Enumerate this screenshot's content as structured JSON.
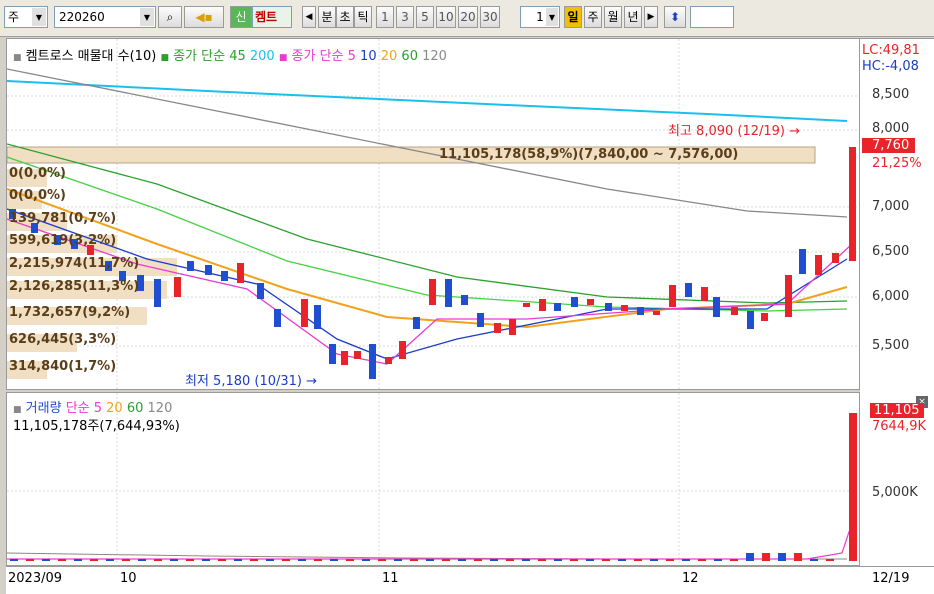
{
  "toolbar": {
    "period_select": "주",
    "code": "220260",
    "new_badge": "신",
    "stock_name": "켐트",
    "prev_arrow": "◀",
    "tabs": [
      "분",
      "초",
      "틱"
    ],
    "intervals": [
      "1",
      "3",
      "5",
      "10",
      "20",
      "30"
    ],
    "interval_value": "1",
    "periods": [
      "일",
      "주",
      "월",
      "년"
    ],
    "active_period": "일",
    "next_arrow": "▶"
  },
  "legend": {
    "title": "켐트로스 매물대 수(10)",
    "ma_long": "종가 단순 45",
    "ma_long_2": "200",
    "ma_short": "종가 단순 5",
    "ma_10": "10",
    "ma_20": "20",
    "ma_60": "60",
    "ma_120": "120"
  },
  "right_axis": {
    "lc": "LC:49,81",
    "hc": "HC:-4,08",
    "current_price": "7,760",
    "change": "21,25%",
    "ticks": [
      "8,500",
      "8,000",
      "7,000",
      "6,500",
      "6,000",
      "5,500"
    ],
    "vol_current": "11,105",
    "vol_avg": "7644,9K",
    "vol_tick": "5,000K"
  },
  "volume_profile": {
    "highlight": "11,105,178(58,9%)(7,840,00 ~ 7,576,00)",
    "rows": [
      "0(0,0%)",
      "0(0,0%)",
      "139,781(0,7%)",
      "599,619(3,2%)",
      "2,215,974(11,7%)",
      "2,126,285(11,3%)",
      "1,732,657(9,2%)",
      "626,445(3,3%)",
      "314,840(1,7%)"
    ]
  },
  "annotations": {
    "high": "최고 8,090 (12/19)",
    "low": "최저 5,180 (10/31)"
  },
  "volume_legend": {
    "title": "거래량",
    "ma": "단순 5",
    "ma_20": "20",
    "ma_60": "60",
    "ma_120": "120",
    "summary": "11,105,178주(7,644,93%)"
  },
  "x_axis": [
    "2023/09",
    "10",
    "11",
    "12",
    "12/19"
  ],
  "colors": {
    "up": "#e8232a",
    "down": "#1f4fd0",
    "ma5": "#e83cd0",
    "ma10": "#1a3cc8",
    "ma20": "#f0a21e",
    "ma60": "#2ca02c",
    "ma120": "#888888",
    "ma200": "#19c0ec"
  }
}
